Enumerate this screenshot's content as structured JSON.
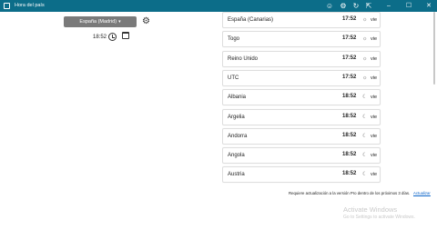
{
  "window": {
    "title": "Hora del país",
    "controls": [
      "minimize",
      "maximize",
      "close"
    ]
  },
  "toolbar_icons": [
    "people-icon",
    "settings-icon",
    "refresh-icon",
    "share-icon"
  ],
  "selector": {
    "country": "España (Madrid)",
    "time": "18:52"
  },
  "zones": [
    {
      "country": "España (Canarias)",
      "time": "17:52",
      "period": "day",
      "day": "vie"
    },
    {
      "country": "Togo",
      "time": "17:52",
      "period": "day",
      "day": "vie"
    },
    {
      "country": "Reino Unido",
      "time": "17:52",
      "period": "day",
      "day": "vie"
    },
    {
      "country": "UTC",
      "time": "17:52",
      "period": "day",
      "day": "vie"
    },
    {
      "country": "Albania",
      "time": "18:52",
      "period": "night",
      "day": "vie"
    },
    {
      "country": "Argelia",
      "time": "18:52",
      "period": "night",
      "day": "vie"
    },
    {
      "country": "Andorra",
      "time": "18:52",
      "period": "night",
      "day": "vie"
    },
    {
      "country": "Angola",
      "time": "18:52",
      "period": "night",
      "day": "vie"
    },
    {
      "country": "Austria",
      "time": "18:52",
      "period": "night",
      "day": "vie"
    }
  ],
  "update_notice": {
    "message": "Requiere actualización a la versión Pro dentro de los próximos 3 días.",
    "link": "Actualizar"
  },
  "watermark": {
    "title": "Activate Windows",
    "subtitle": "Go to Settings to activate Windows."
  },
  "colors": {
    "titlebar": "#0c6d89",
    "select": "#7a7a7a",
    "link": "#0a63c9"
  }
}
